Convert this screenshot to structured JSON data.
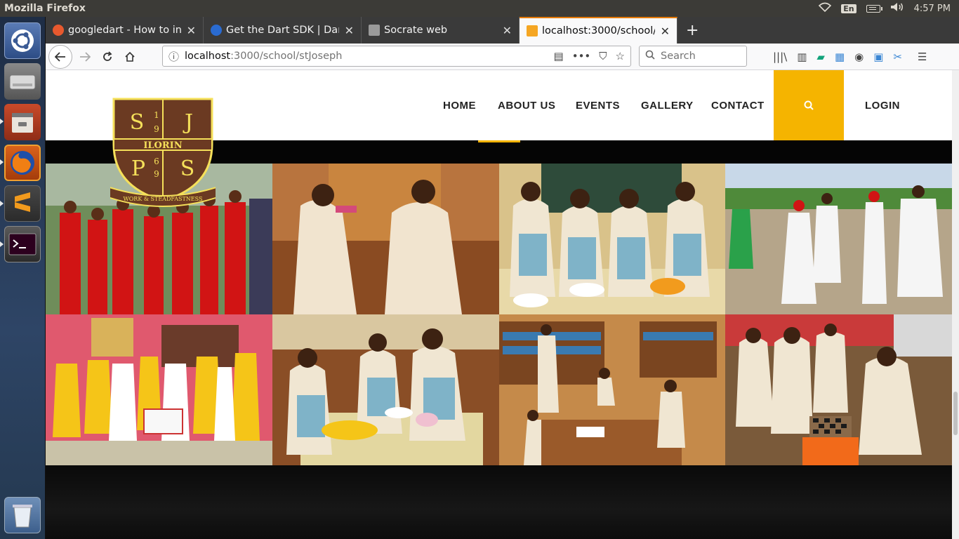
{
  "os": {
    "window_title": "Mozilla Firefox",
    "keyboard": "En",
    "time": "4:57 PM"
  },
  "launcher": {
    "items": [
      "ubuntu-dash",
      "files-drive",
      "file-manager",
      "firefox",
      "sublime-text",
      "terminal",
      "trash"
    ]
  },
  "browser": {
    "tabs": [
      {
        "title": "googledart - How to inst",
        "favicon_color": "#e8592e"
      },
      {
        "title": "Get the Dart SDK | Dart",
        "favicon_color": "#2a6bd1"
      },
      {
        "title": "Socrate web",
        "favicon_color": "#9a9a9a"
      },
      {
        "title": "localhost:3000/school/s",
        "favicon_color": "#f5a623"
      }
    ],
    "url_host": "localhost",
    "url_path": ":3000/school/stJoseph",
    "search_placeholder": "Search"
  },
  "site": {
    "crest": {
      "letters_top": [
        "S",
        "J"
      ],
      "digits": [
        "1",
        "9",
        "6",
        "9"
      ],
      "band_text": "ILORIN",
      "letters_bottom": [
        "P",
        "S"
      ],
      "motto": "WORK & STEADFASTNESS"
    },
    "nav": {
      "home": "HOME",
      "about": "ABOUT US",
      "events": "EVENTS",
      "gallery": "GALLERY",
      "contact": "CONTACT",
      "login": "LOGIN"
    },
    "accent_color": "#f5b400"
  }
}
